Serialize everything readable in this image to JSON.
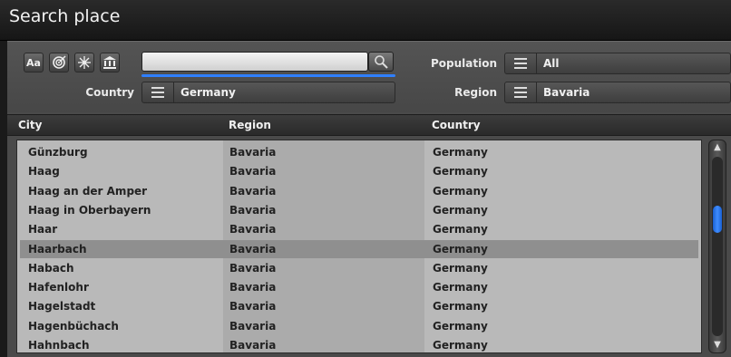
{
  "window": {
    "title": "Search place"
  },
  "toolbar": {
    "text_button_label": "Aa",
    "icons": [
      "target-icon",
      "snowflake-icon",
      "museum-icon"
    ],
    "search": {
      "value": "",
      "placeholder": ""
    }
  },
  "filters": {
    "country": {
      "label": "Country",
      "value": "Germany"
    },
    "population": {
      "label": "Population",
      "value": "All"
    },
    "region": {
      "label": "Region",
      "value": "Bavaria"
    }
  },
  "list": {
    "columns": [
      "City",
      "Region",
      "Country"
    ],
    "selected_index": 5,
    "rows": [
      {
        "city": "Günzburg",
        "region": "Bavaria",
        "country": "Germany"
      },
      {
        "city": "Haag",
        "region": "Bavaria",
        "country": "Germany"
      },
      {
        "city": "Haag an der Amper",
        "region": "Bavaria",
        "country": "Germany"
      },
      {
        "city": "Haag in Oberbayern",
        "region": "Bavaria",
        "country": "Germany"
      },
      {
        "city": "Haar",
        "region": "Bavaria",
        "country": "Germany"
      },
      {
        "city": "Haarbach",
        "region": "Bavaria",
        "country": "Germany"
      },
      {
        "city": "Habach",
        "region": "Bavaria",
        "country": "Germany"
      },
      {
        "city": "Hafenlohr",
        "region": "Bavaria",
        "country": "Germany"
      },
      {
        "city": "Hagelstadt",
        "region": "Bavaria",
        "country": "Germany"
      },
      {
        "city": "Hagenbüchach",
        "region": "Bavaria",
        "country": "Germany"
      },
      {
        "city": "Hahnbach",
        "region": "Bavaria",
        "country": "Germany"
      }
    ]
  },
  "colors": {
    "accent": "#2f7fff",
    "selected_row": "#8f8f8f"
  }
}
